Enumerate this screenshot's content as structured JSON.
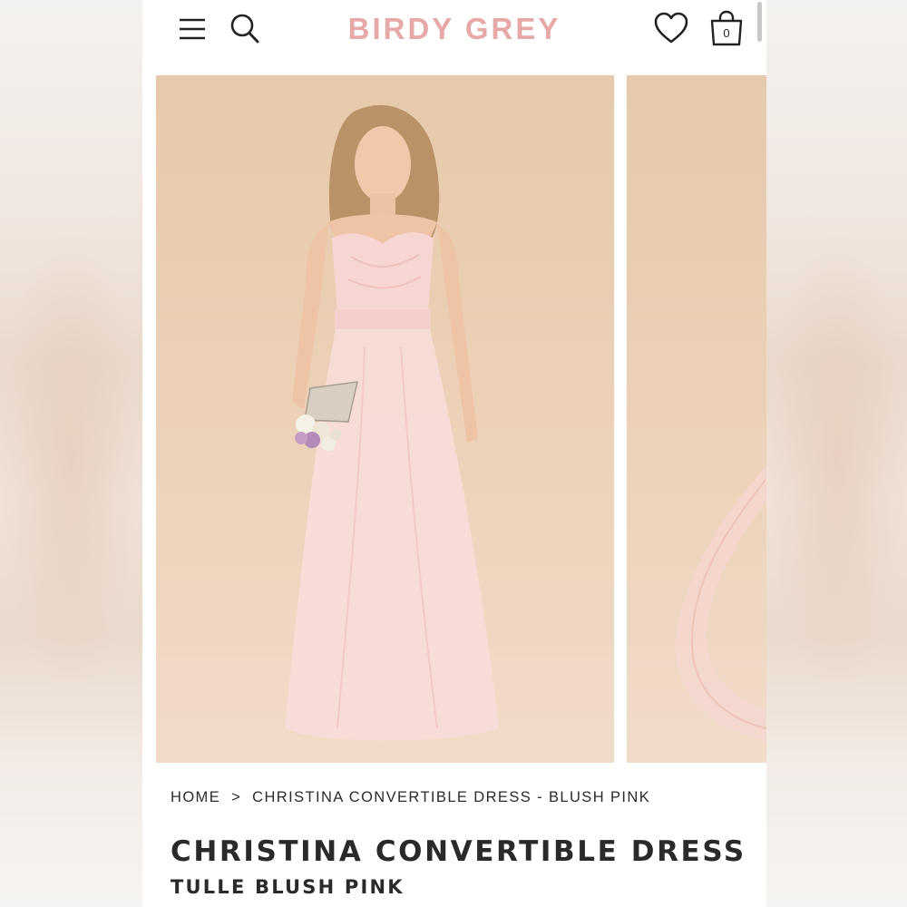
{
  "header": {
    "logo_text": "BIRDY GREY",
    "bag_count": "0",
    "brand_color": "#e6a9a8"
  },
  "gallery": {
    "images": [
      {
        "name": "model-wearing-blush-pink-strapless-tulle-dress"
      },
      {
        "name": "blush-pink-tulle-sash-detail"
      }
    ]
  },
  "breadcrumb": {
    "home": "HOME",
    "separator": ">",
    "current": "CHRISTINA CONVERTIBLE DRESS - BLUSH PINK"
  },
  "product": {
    "title": "CHRISTINA CONVERTIBLE DRESS",
    "subtitle": "TULLE BLUSH PINK"
  },
  "icons": [
    "menu-icon",
    "search-icon",
    "heart-icon",
    "shopping-bag-icon"
  ]
}
